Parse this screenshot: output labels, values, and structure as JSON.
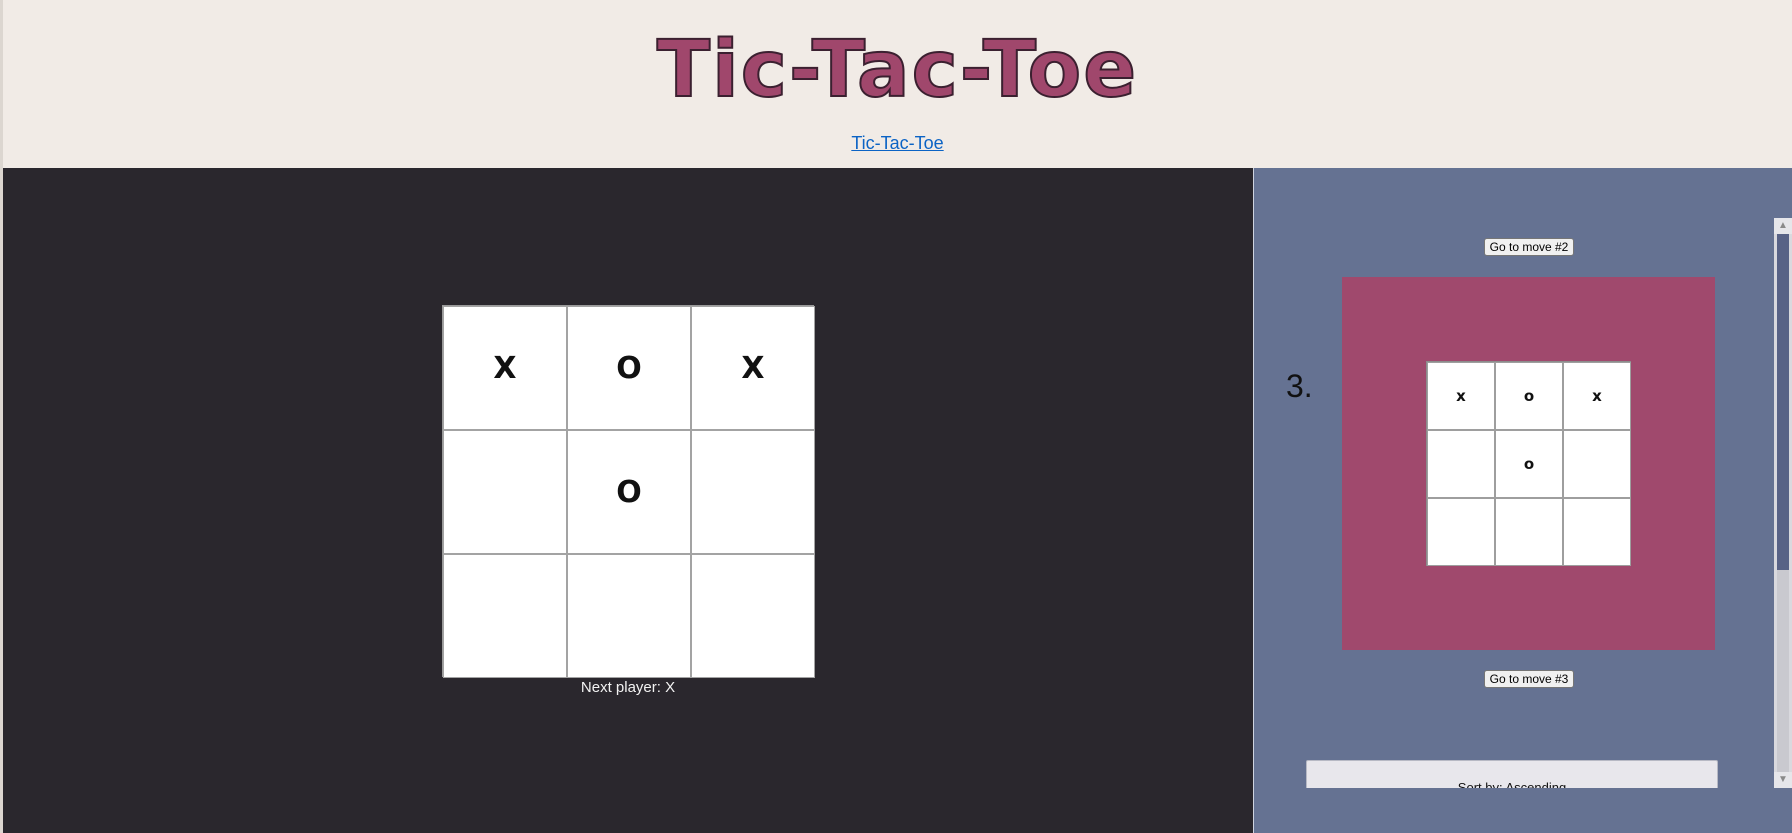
{
  "header": {
    "title": "Tic-Tac-Toe",
    "link_label": "Tic-Tac-Toe"
  },
  "game": {
    "board": [
      "X",
      "O",
      "X",
      "",
      "O",
      "",
      "",
      "",
      ""
    ],
    "status": "Next player: X"
  },
  "history": {
    "go_to_move_2_label": "Go to move #2",
    "go_to_move_3_label": "Go to move #3",
    "move_index_label": "3.",
    "preview_board": [
      "x",
      "o",
      "x",
      "",
      "o",
      "",
      "",
      "",
      ""
    ],
    "sort_label": "Sort by: Ascending"
  },
  "colors": {
    "header_bg": "#f1ebe6",
    "title": "#a0476c",
    "game_bg": "#2a272d",
    "sidebar_bg": "#657292",
    "preview_frame": "#a0496d",
    "link": "#0b63c5"
  },
  "scrollbar": {
    "position_fraction": 0.65
  }
}
